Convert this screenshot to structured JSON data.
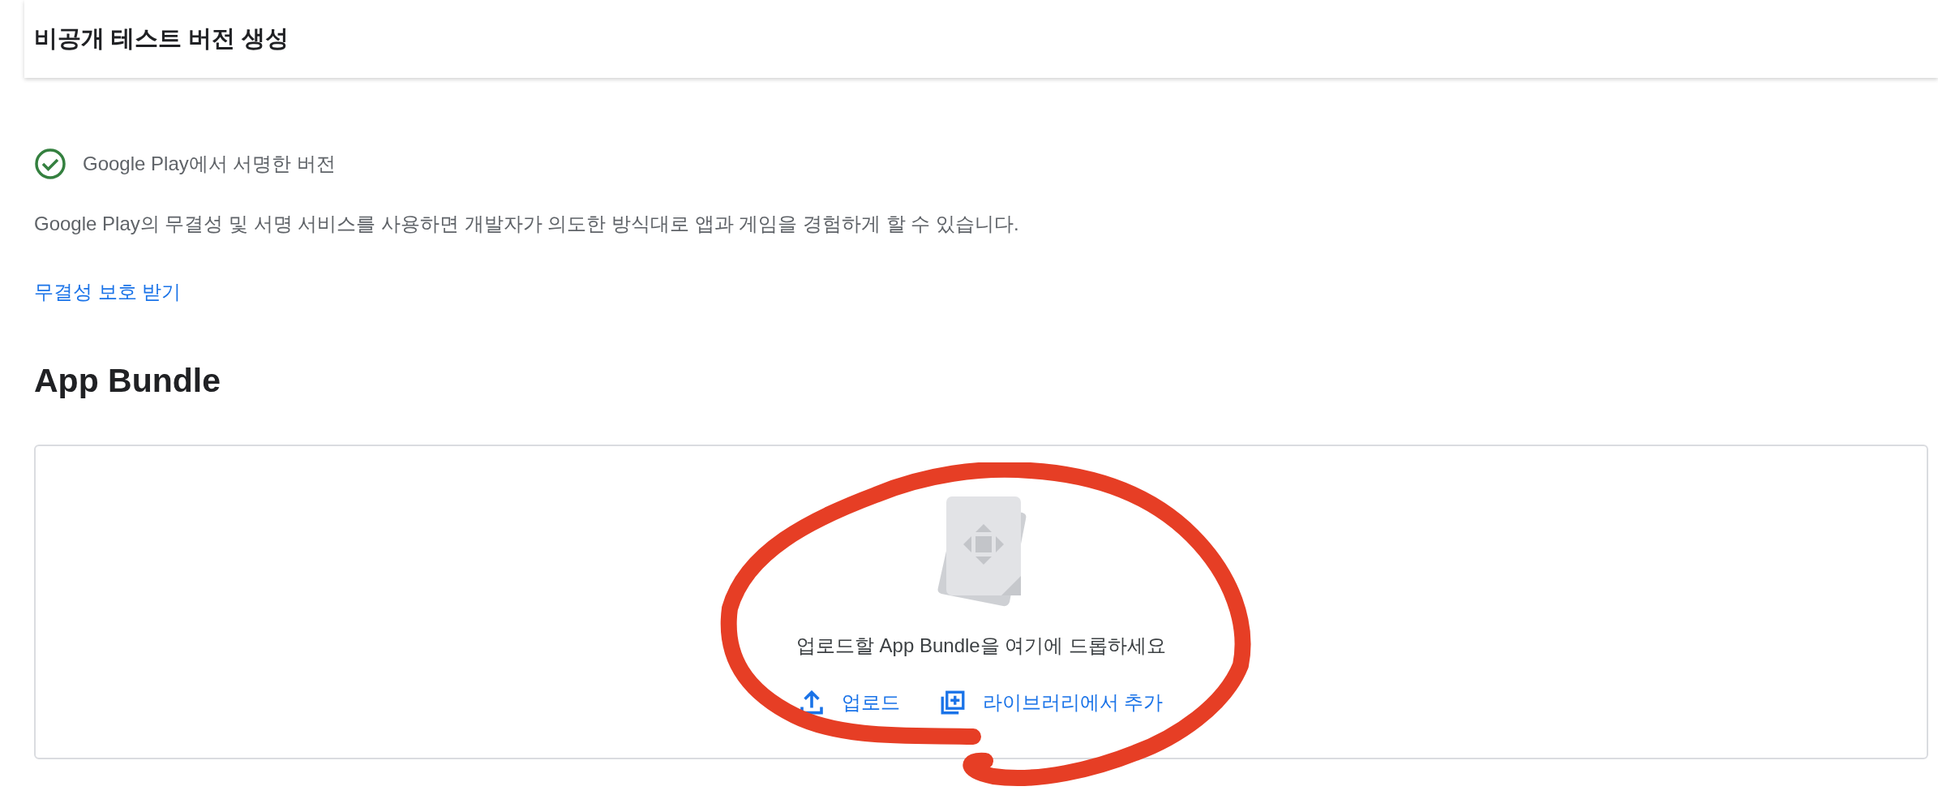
{
  "header": {
    "title": "비공개 테스트 버전 생성"
  },
  "signing": {
    "status": "Google Play에서 서명한 버전",
    "signed": true,
    "description": "Google Play의 무결성 및 서명 서비스를 사용하면 개발자가 의도한 방식대로 앱과 게임을 경험하게 할 수 있습니다.",
    "link": "무결성 보호 받기"
  },
  "app_bundle": {
    "heading": "App Bundle",
    "drop_text": "업로드할 App Bundle을 여기에 드롭하세요",
    "actions": [
      {
        "kind": "upload",
        "label": "업로드"
      },
      {
        "kind": "library",
        "label": "라이브러리에서 추가"
      }
    ]
  },
  "annotation": {
    "kind": "circle",
    "color": "#e63e25"
  }
}
